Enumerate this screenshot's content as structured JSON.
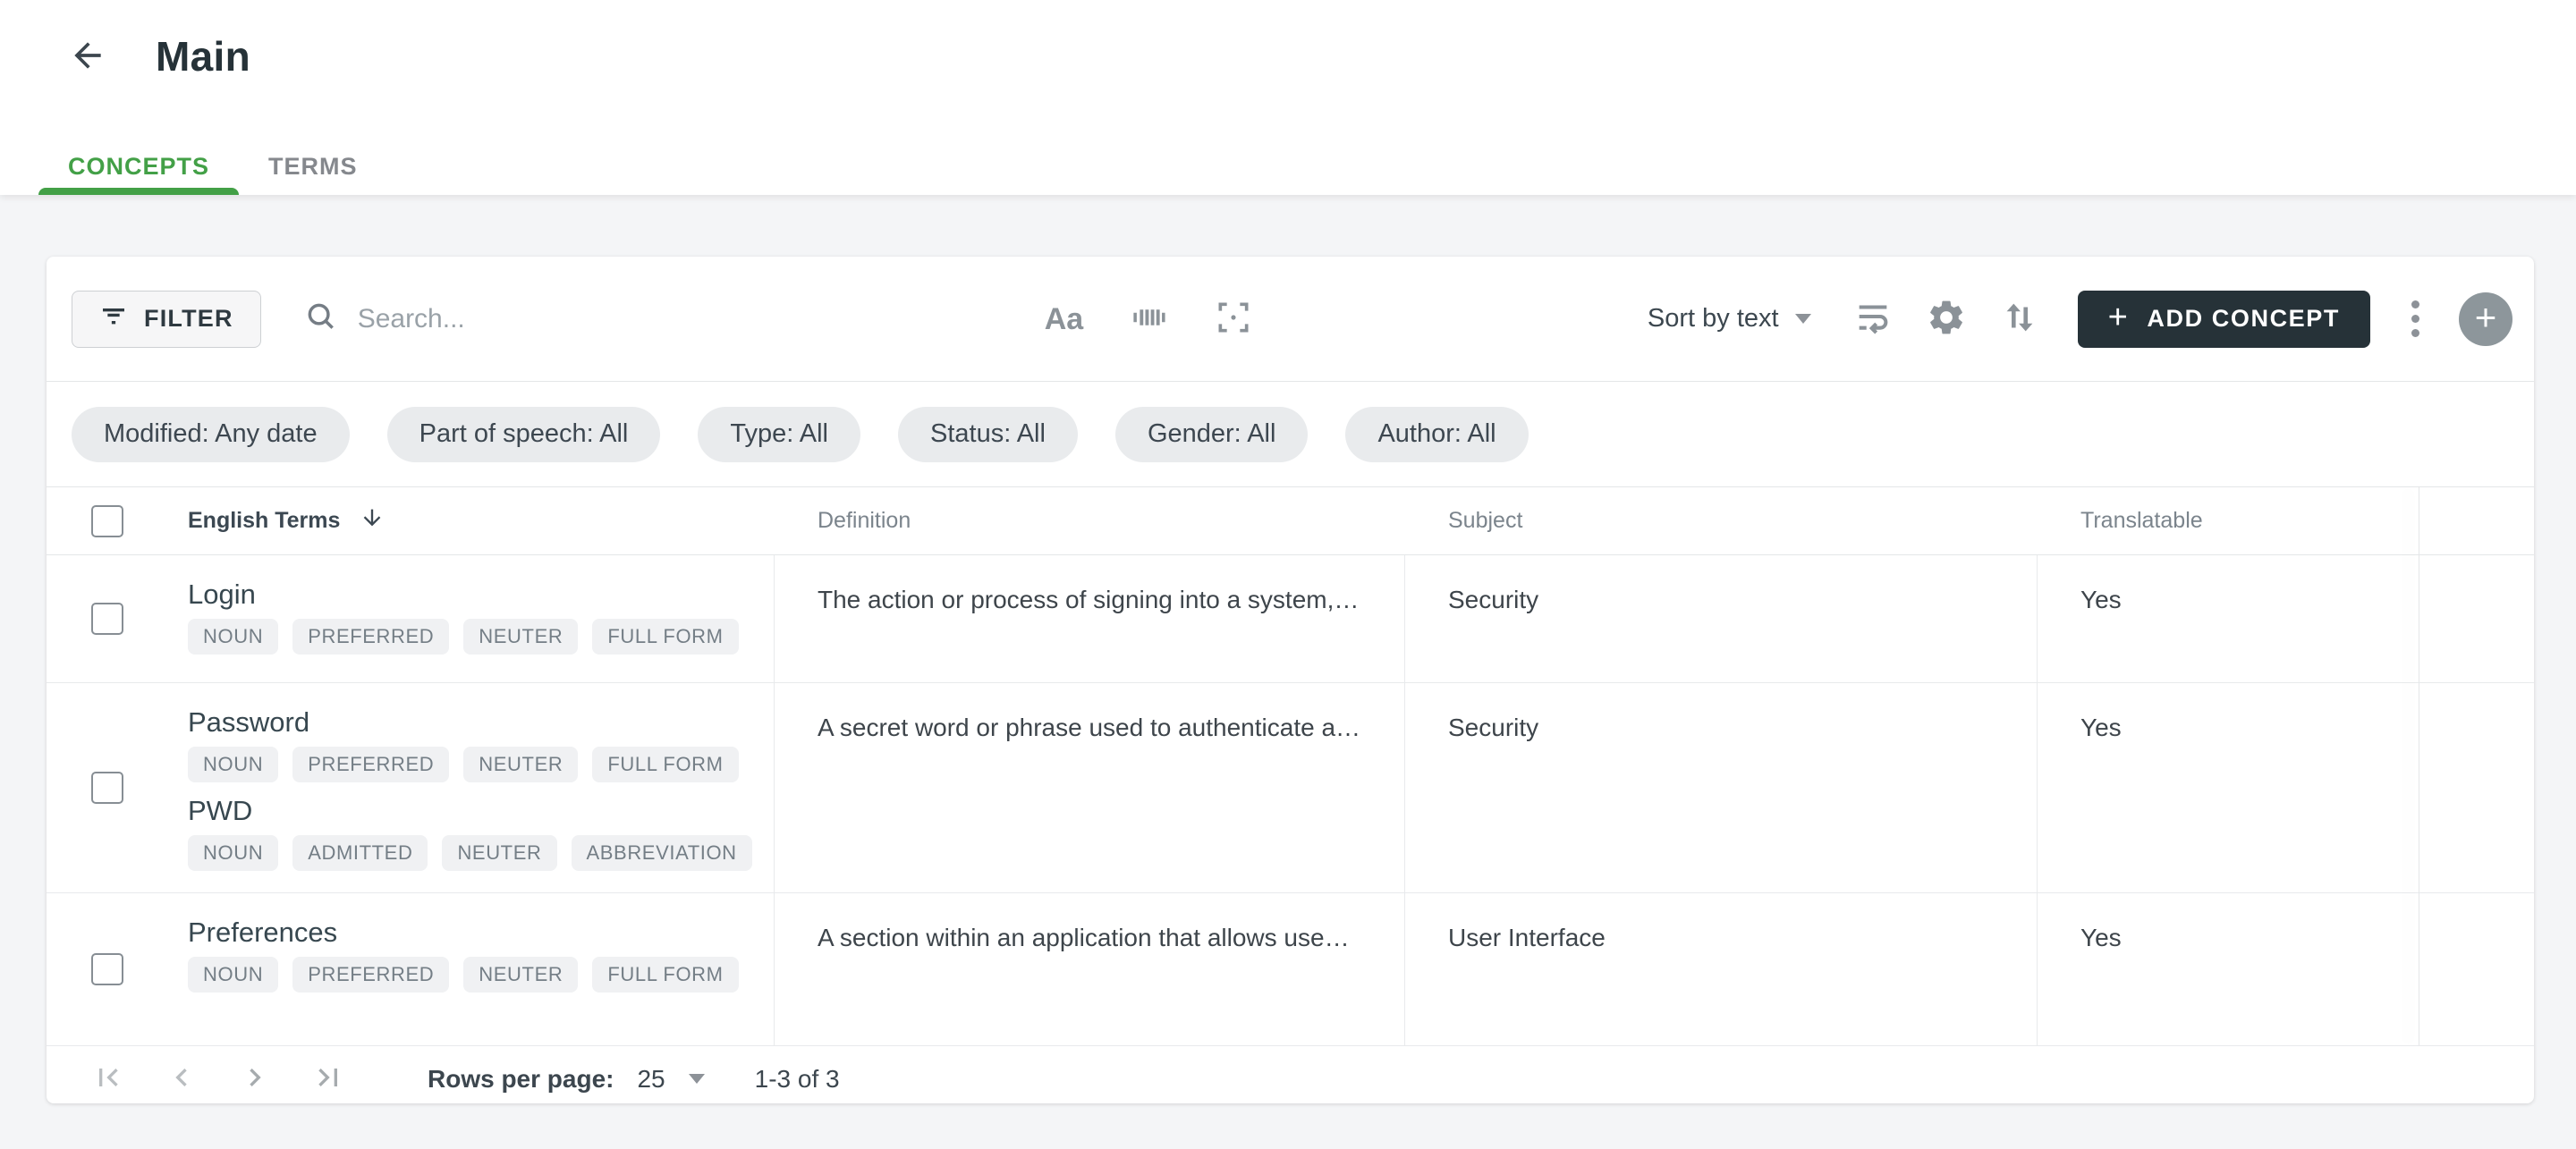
{
  "header": {
    "title": "Main"
  },
  "tabs": [
    {
      "label": "CONCEPTS",
      "active": true
    },
    {
      "label": "TERMS",
      "active": false
    }
  ],
  "toolbar": {
    "filter_label": "FILTER",
    "search_placeholder": "Search...",
    "sort_label": "Sort by text",
    "add_button_label": "ADD CONCEPT",
    "add_button_plus": "+",
    "icons": [
      "filter-list-icon",
      "search-icon",
      "match-case-icon",
      "barcode-icon",
      "selection-frame-icon",
      "wrap-text-icon",
      "gear-icon",
      "swap-vertical-icon",
      "kebab-menu-icon",
      "plus-circle-icon"
    ]
  },
  "filters": [
    "Modified: Any date",
    "Part of speech: All",
    "Type: All",
    "Status: All",
    "Gender: All",
    "Author: All"
  ],
  "table": {
    "columns": {
      "terms": "English Terms",
      "definition": "Definition",
      "subject": "Subject",
      "translatable": "Translatable"
    },
    "sort_column_icon": "arrow-down-icon",
    "rows": [
      {
        "terms": [
          {
            "text": "Login",
            "badges": [
              "NOUN",
              "PREFERRED",
              "NEUTER",
              "FULL FORM"
            ]
          }
        ],
        "definition": "The action or process of signing into a system,…",
        "subject": "Security",
        "translatable": "Yes"
      },
      {
        "terms": [
          {
            "text": "Password",
            "badges": [
              "NOUN",
              "PREFERRED",
              "NEUTER",
              "FULL FORM"
            ]
          },
          {
            "text": "PWD",
            "badges": [
              "NOUN",
              "ADMITTED",
              "NEUTER",
              "ABBREVIATION"
            ]
          }
        ],
        "definition": "A secret word or phrase used to authenticate a…",
        "subject": "Security",
        "translatable": "Yes"
      },
      {
        "terms": [
          {
            "text": "Preferences",
            "badges": [
              "NOUN",
              "PREFERRED",
              "NEUTER",
              "FULL FORM"
            ]
          }
        ],
        "definition": "A section within an application that allows use…",
        "subject": "User Interface",
        "translatable": "Yes"
      }
    ]
  },
  "pagination": {
    "rows_per_page_label": "Rows per page:",
    "rows_per_page_value": "25",
    "range_label": "1-3 of 3"
  },
  "colors": {
    "accent_green": "#43a047",
    "button_dark": "#263238",
    "page_bg": "#f4f5f7",
    "chip_bg": "#e9ebed",
    "badge_bg": "#f0f1f3",
    "text_dark": "#37474f",
    "text_gray": "#7b848c",
    "icon_gray": "#8b9298"
  }
}
